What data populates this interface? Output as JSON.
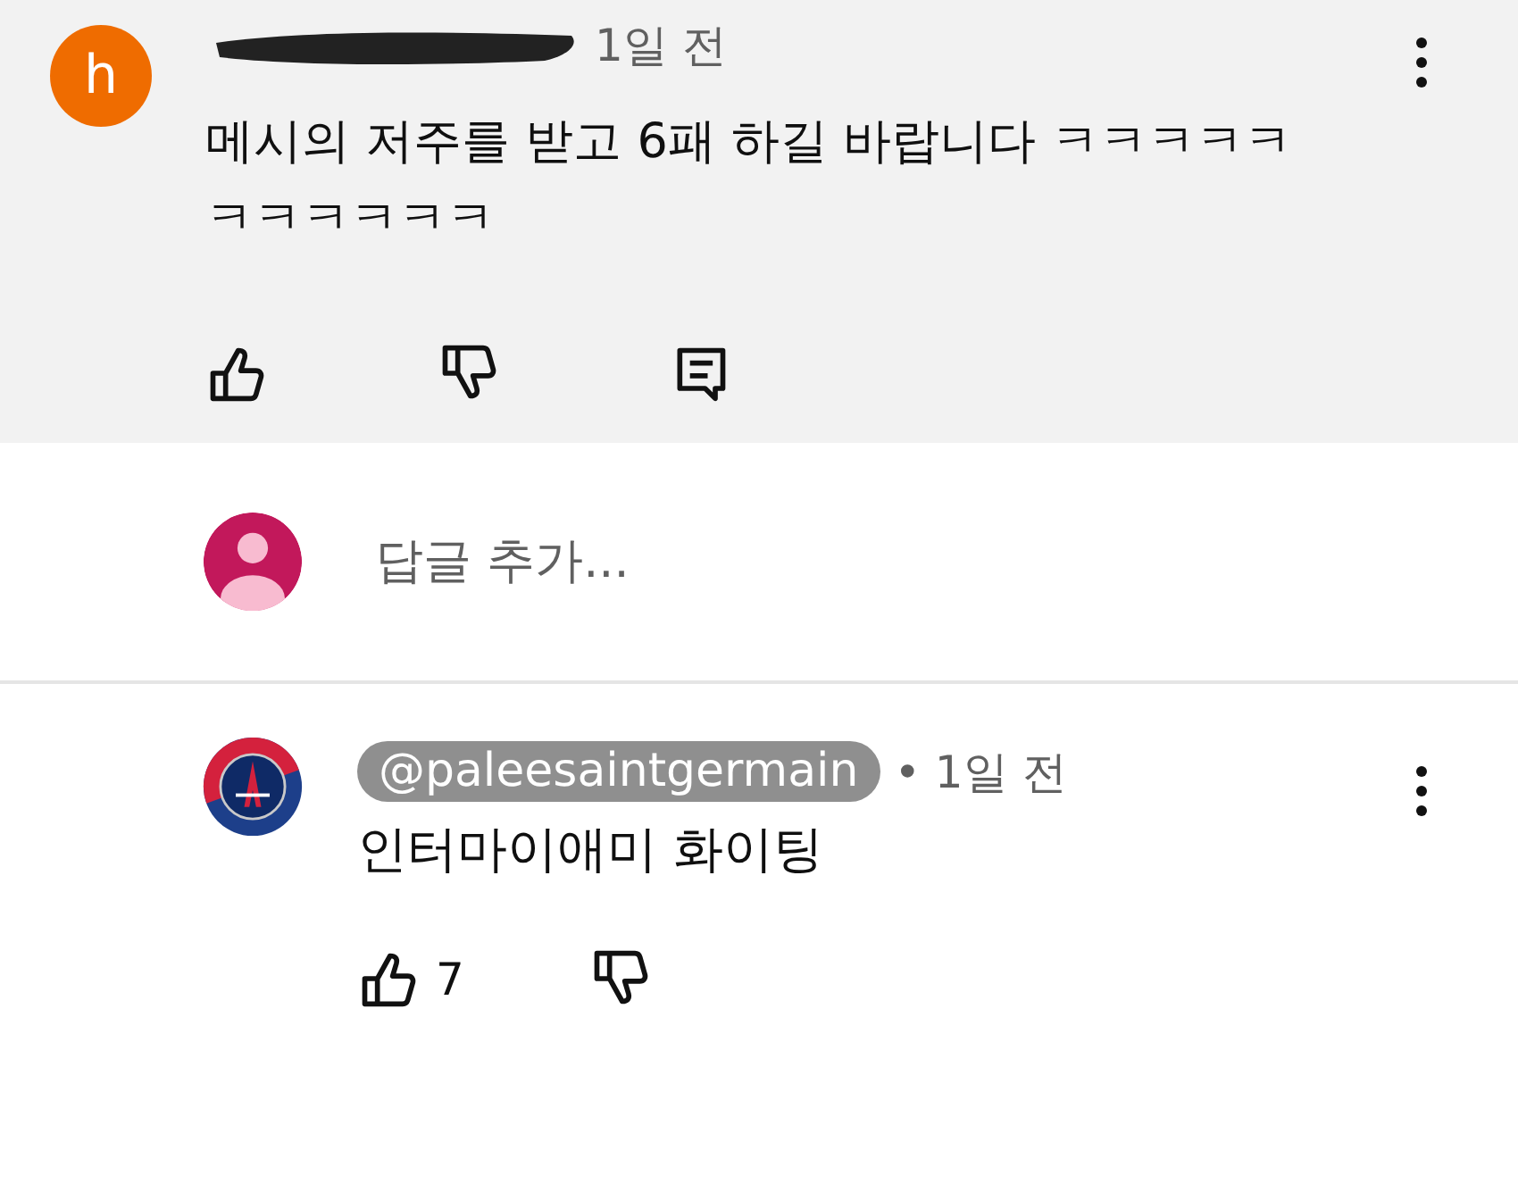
{
  "comments": [
    {
      "highlighted": true,
      "avatar": {
        "kind": "letter",
        "letter": "h",
        "color": "#ef6c00"
      },
      "author_hidden": true,
      "time": "1일 전",
      "text": "메시의 저주를 받고 6패 하길 바랍니다 ㅋㅋㅋㅋㅋㅋㅋㅋㅋㅋㅋ",
      "reply_button": true
    },
    {
      "highlighted": false,
      "avatar": {
        "kind": "crest"
      },
      "author_hidden": false,
      "handle": "@paleesaintgermain",
      "time": "• 1일 전",
      "text": "인터마이애미 화이팅",
      "likes": "7",
      "reply_button": false
    }
  ],
  "reply_box": {
    "placeholder": "답글 추가..."
  }
}
